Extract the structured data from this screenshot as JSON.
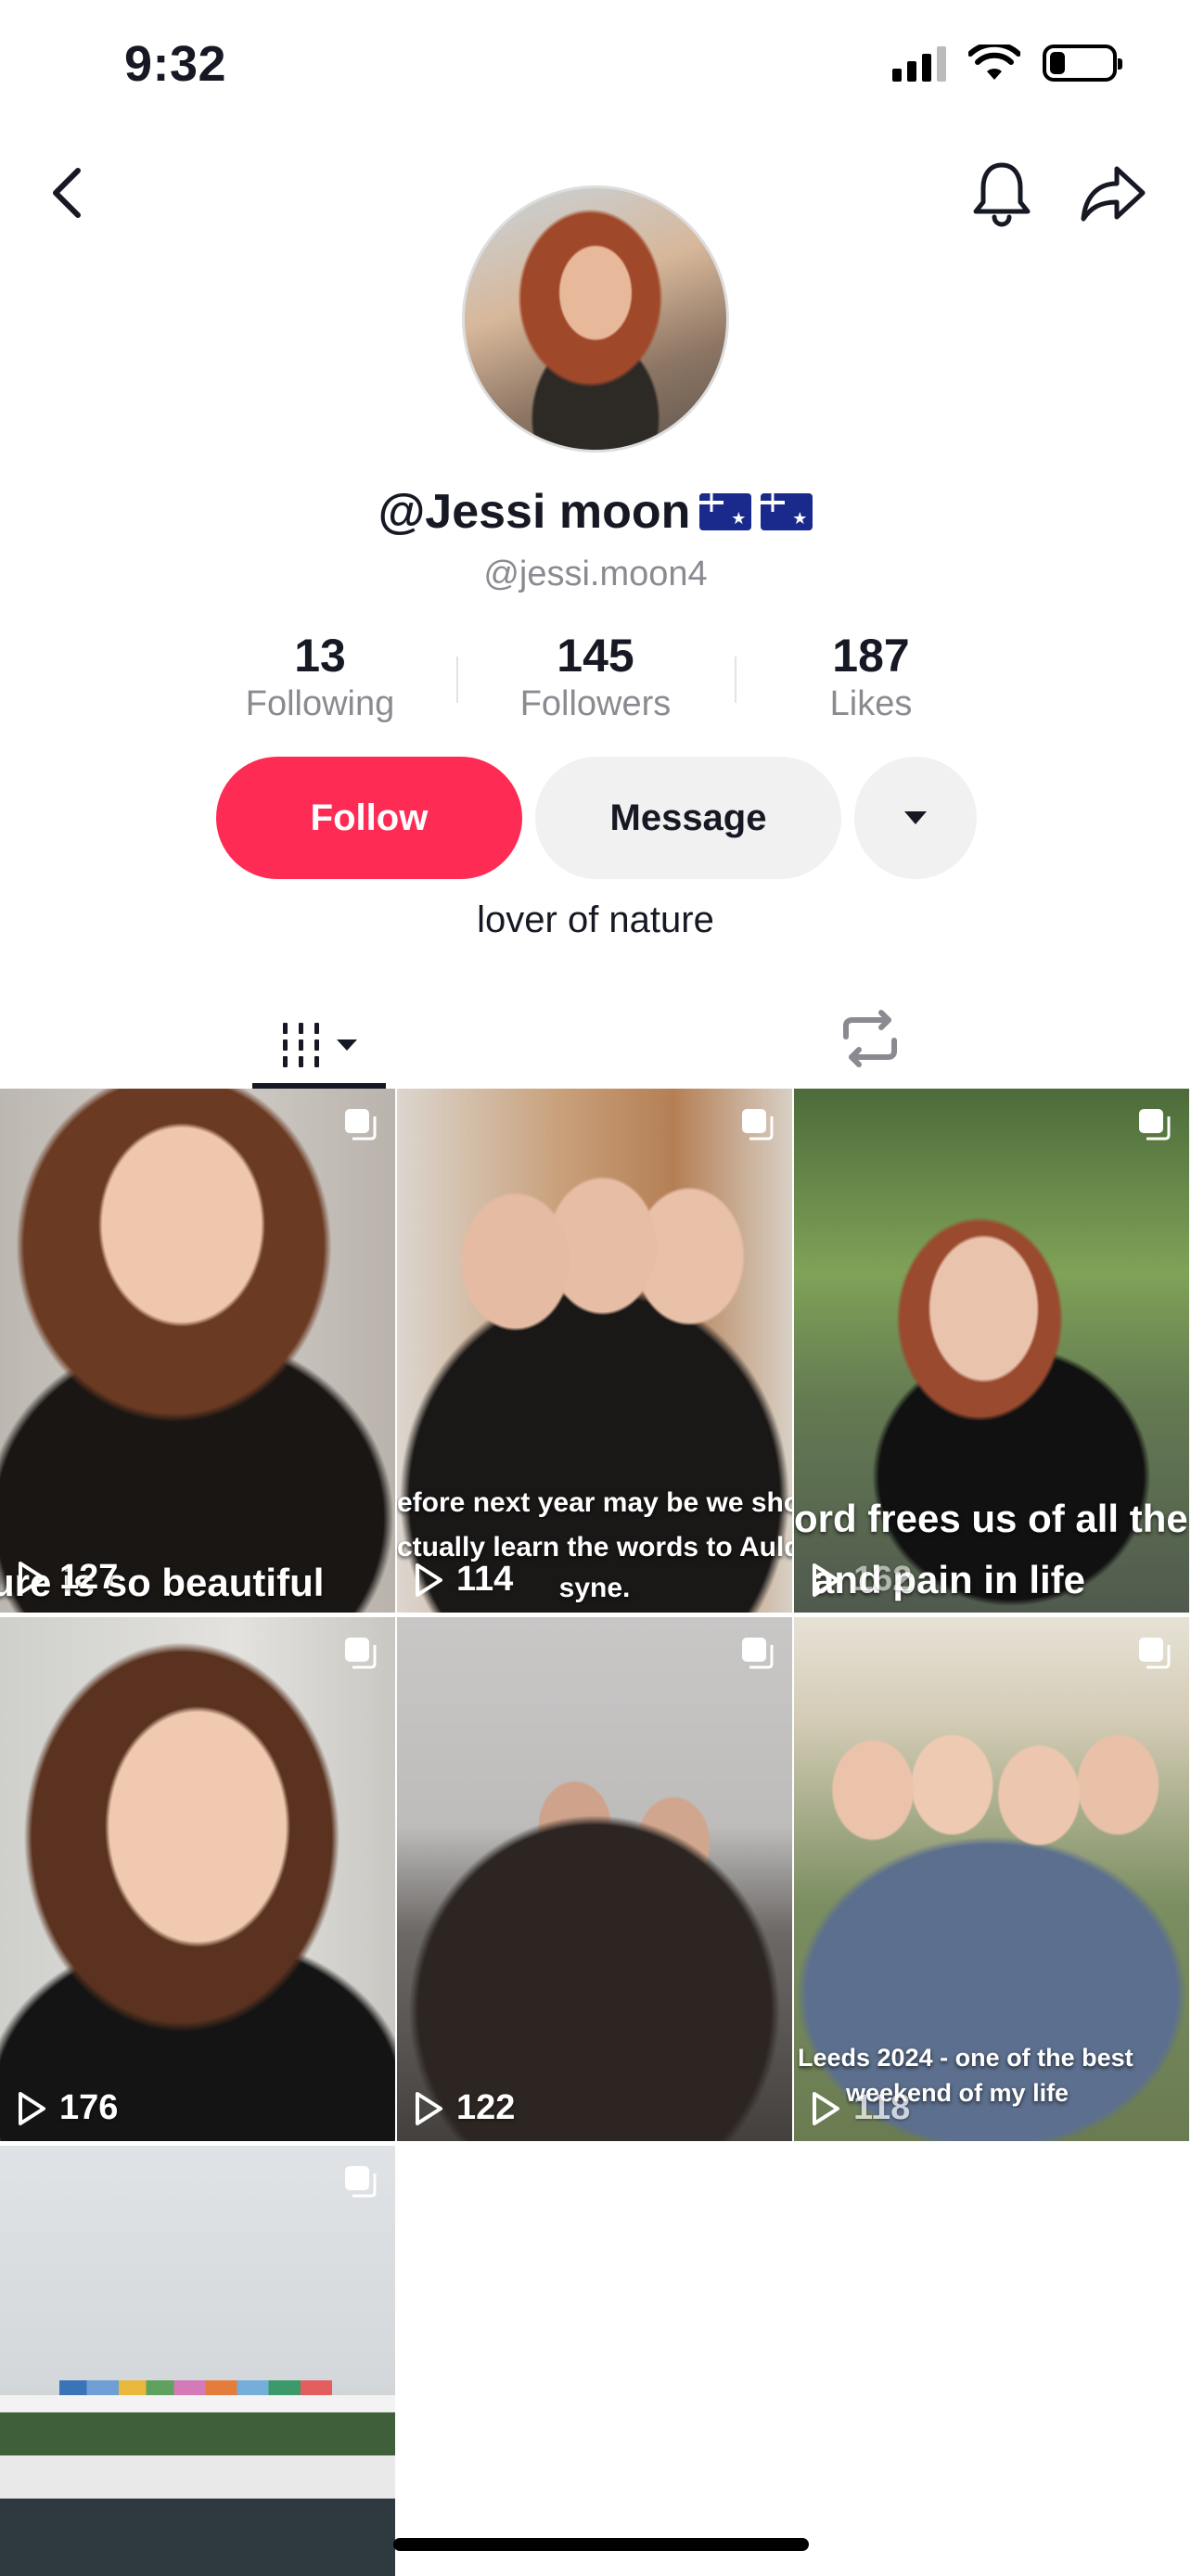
{
  "status_bar": {
    "time": "9:32"
  },
  "profile": {
    "display_name": "@Jessi moon",
    "username": "@jessi.moon4",
    "bio": "lover of nature"
  },
  "stats": [
    {
      "value": "13",
      "label": "Following"
    },
    {
      "value": "145",
      "label": "Followers"
    },
    {
      "value": "187",
      "label": "Likes"
    }
  ],
  "actions": {
    "follow": "Follow",
    "message": "Message"
  },
  "colors": {
    "accent": "#fe2c55",
    "secondary_button": "#f1f1f2",
    "muted_text": "#8a8b91"
  },
  "videos": [
    {
      "views": "127",
      "caption": "ure is so beautiful"
    },
    {
      "views": "114",
      "caption": "efore next year may be we shou",
      "caption_line2": "ctually learn the words to Auld la",
      "caption_line3": "syne."
    },
    {
      "views": "162",
      "caption": "ord frees us of all the w",
      "caption_line2": "and pain in life"
    },
    {
      "views": "176"
    },
    {
      "views": "122"
    },
    {
      "views": "118",
      "caption": "Leeds 2024 - one of the best",
      "caption_line2": "weekend of my life"
    },
    {}
  ]
}
